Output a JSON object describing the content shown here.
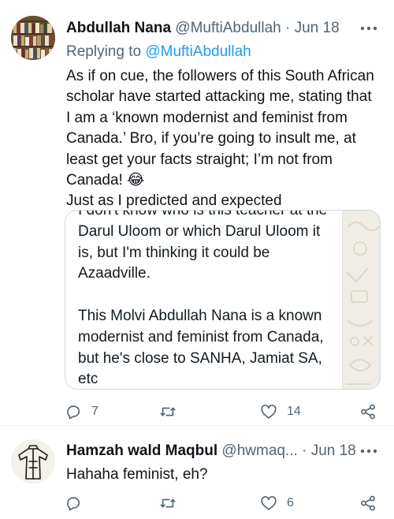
{
  "tweets": [
    {
      "display_name": "Abdullah Nana",
      "handle": "@MuftiAbdullah",
      "separator": "·",
      "date": "Jun 18",
      "replying_prefix": "Replying to",
      "replying_handle": "@MuftiAbdullah",
      "text_lines": [
        "As if on cue, the followers of this South African",
        "scholar have started attacking me, stating that",
        "I am a ‘known modernist and feminist from",
        "Canada.’ Bro, if you’re going to insult me, at",
        "least get your facts straight; I’m not from",
        "Canada! 😂",
        "Just as I predicted and expected"
      ],
      "media_lines": [
        "I don't know who is this teacher at the",
        "Darul Uloom or which Darul Uloom it",
        "is, but I'm thinking it could be",
        "Azaadville.",
        "This Molvi Abdullah Nana is a known",
        "modernist and feminist from Canada,",
        "but he's close to SANHA, Jamiat SA,",
        "etc"
      ],
      "reply_count": "7",
      "retweet_count": "",
      "like_count": "14"
    },
    {
      "display_name": "Hamzah wald Maqbul",
      "handle": "@hwmaq...",
      "separator": "·",
      "date": "Jun 18",
      "text": "Hahaha feminist, eh?",
      "reply_count": "",
      "retweet_count": "",
      "like_count": "6"
    }
  ],
  "icons": {
    "more": "more-horizontal-icon",
    "reply": "reply-bubble-icon",
    "retweet": "retweet-arrows-icon",
    "like": "heart-outline-icon",
    "share": "share-nodes-icon"
  },
  "colors": {
    "text_primary": "#0f1419",
    "text_secondary": "#536471",
    "link": "#1d9bf0",
    "border": "#cfd9de",
    "background": "#ffffff"
  }
}
